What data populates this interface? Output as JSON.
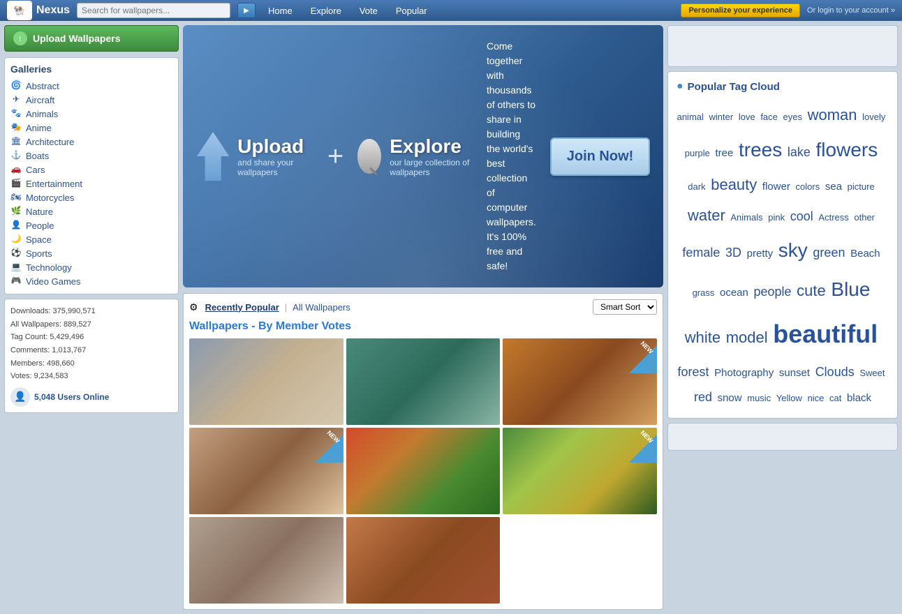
{
  "header": {
    "logo_text": "Nexus",
    "search_placeholder": "Search for wallpapers...",
    "search_btn_label": "▶",
    "nav_items": [
      "Home",
      "Explore",
      "Vote",
      "Popular"
    ],
    "personalize_btn": "Personalize your experience",
    "login_link": "Or login to your account »"
  },
  "sidebar": {
    "upload_btn": "Upload Wallpapers",
    "galleries_title": "Galleries",
    "galleries": [
      {
        "label": "Abstract",
        "icon": "🌀"
      },
      {
        "label": "Aircraft",
        "icon": "✈"
      },
      {
        "label": "Animals",
        "icon": "🐾"
      },
      {
        "label": "Anime",
        "icon": "🎭"
      },
      {
        "label": "Architecture",
        "icon": "🏛"
      },
      {
        "label": "Boats",
        "icon": "⚓"
      },
      {
        "label": "Cars",
        "icon": "🚗"
      },
      {
        "label": "Entertainment",
        "icon": "🎬"
      },
      {
        "label": "Motorcycles",
        "icon": "🏍"
      },
      {
        "label": "Nature",
        "icon": "🌿"
      },
      {
        "label": "People",
        "icon": "👤"
      },
      {
        "label": "Space",
        "icon": "🌙"
      },
      {
        "label": "Sports",
        "icon": "⚽"
      },
      {
        "label": "Technology",
        "icon": "💻"
      },
      {
        "label": "Video Games",
        "icon": "🎮"
      }
    ],
    "stats": {
      "downloads": "Downloads: 375,990,571",
      "wallpapers": "All Wallpapers: 889,527",
      "tags": "Tag Count: 5,429,496",
      "comments": "Comments: 1,013,767",
      "members": "Members: 498,660",
      "votes": "Votes: 9,234,583"
    },
    "users_online": "5,048 Users Online"
  },
  "banner": {
    "upload_title": "Upload",
    "upload_subtitle": "and share your wallpapers",
    "explore_title": "Explore",
    "explore_subtitle": "our large collection of wallpapers",
    "description": "Come together with thousands of others to share in building the world's best collection of computer wallpapers. It's 100% free and safe!",
    "join_btn": "Join Now!"
  },
  "wallpapers_section": {
    "tab_recently": "Recently Popular",
    "tab_all": "All Wallpapers",
    "sort_label": "Smart Sort",
    "section_title": "Wallpapers - By Member Votes",
    "thumbs": [
      {
        "id": 1,
        "is_new": false,
        "color_class": "wp-1"
      },
      {
        "id": 2,
        "is_new": false,
        "color_class": "wp-2"
      },
      {
        "id": 3,
        "is_new": true,
        "color_class": "wp-3"
      },
      {
        "id": 4,
        "is_new": true,
        "color_class": "wp-4"
      },
      {
        "id": 5,
        "is_new": false,
        "color_class": "wp-5"
      },
      {
        "id": 6,
        "is_new": true,
        "color_class": "wp-6"
      },
      {
        "id": 7,
        "is_new": false,
        "color_class": "wp-7"
      },
      {
        "id": 8,
        "is_new": false,
        "color_class": "wp-8"
      }
    ],
    "new_badge_text": "NEW"
  },
  "tag_cloud": {
    "title": "Popular Tag Cloud",
    "tags": [
      {
        "label": "animal",
        "size": "sm"
      },
      {
        "label": "winter",
        "size": "sm"
      },
      {
        "label": "love",
        "size": "sm"
      },
      {
        "label": "face",
        "size": "sm"
      },
      {
        "label": "eyes",
        "size": "sm"
      },
      {
        "label": "woman",
        "size": "xl"
      },
      {
        "label": "lovely",
        "size": "sm"
      },
      {
        "label": "purple",
        "size": "sm"
      },
      {
        "label": "tree",
        "size": "md"
      },
      {
        "label": "trees",
        "size": "xxl"
      },
      {
        "label": "lake",
        "size": "lg"
      },
      {
        "label": "flowers",
        "size": "xxl"
      },
      {
        "label": "dark",
        "size": "sm"
      },
      {
        "label": "beauty",
        "size": "xl"
      },
      {
        "label": "flower",
        "size": "md"
      },
      {
        "label": "colors",
        "size": "sm"
      },
      {
        "label": "sea",
        "size": "md"
      },
      {
        "label": "picture",
        "size": "sm"
      },
      {
        "label": "water",
        "size": "xl"
      },
      {
        "label": "Animals",
        "size": "sm"
      },
      {
        "label": "pink",
        "size": "sm"
      },
      {
        "label": "cool",
        "size": "lg"
      },
      {
        "label": "Actress",
        "size": "sm"
      },
      {
        "label": "other",
        "size": "sm"
      },
      {
        "label": "female",
        "size": "lg"
      },
      {
        "label": "3D",
        "size": "lg"
      },
      {
        "label": "pretty",
        "size": "md"
      },
      {
        "label": "sky",
        "size": "xxl"
      },
      {
        "label": "green",
        "size": "lg"
      },
      {
        "label": "Beach",
        "size": "md"
      },
      {
        "label": "grass",
        "size": "sm"
      },
      {
        "label": "ocean",
        "size": "md"
      },
      {
        "label": "people",
        "size": "lg"
      },
      {
        "label": "cute",
        "size": "xl"
      },
      {
        "label": "Blue",
        "size": "xxl"
      },
      {
        "label": "white",
        "size": "xl"
      },
      {
        "label": "model",
        "size": "xl"
      },
      {
        "label": "beautiful",
        "size": "xxxl"
      },
      {
        "label": "forest",
        "size": "lg"
      },
      {
        "label": "Photography",
        "size": "md"
      },
      {
        "label": "sunset",
        "size": "md"
      },
      {
        "label": "Clouds",
        "size": "lg"
      },
      {
        "label": "Sweet",
        "size": "sm"
      },
      {
        "label": "red",
        "size": "lg"
      },
      {
        "label": "snow",
        "size": "md"
      },
      {
        "label": "music",
        "size": "sm"
      },
      {
        "label": "Yellow",
        "size": "sm"
      },
      {
        "label": "nice",
        "size": "sm"
      },
      {
        "label": "cat",
        "size": "sm"
      },
      {
        "label": "black",
        "size": "md"
      }
    ]
  }
}
